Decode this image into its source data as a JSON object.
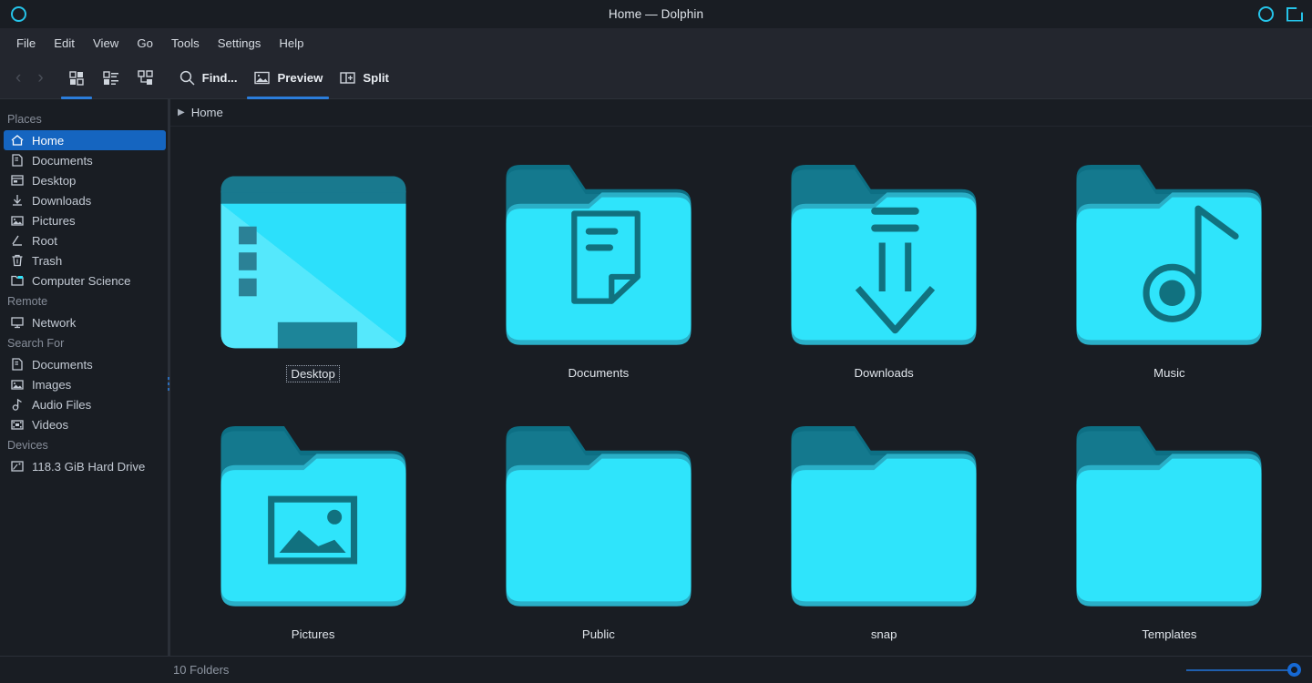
{
  "window": {
    "title": "Home — Dolphin",
    "controls": [
      {
        "name": "circle-icon",
        "label": ""
      },
      {
        "name": "maximize-corner-icon",
        "label": ""
      }
    ]
  },
  "menubar": {
    "items": [
      {
        "label": "File"
      },
      {
        "label": "Edit"
      },
      {
        "label": "View"
      },
      {
        "label": "Go"
      },
      {
        "label": "Tools"
      },
      {
        "label": "Settings"
      },
      {
        "label": "Help"
      }
    ]
  },
  "toolbar": {
    "back_label": "‹",
    "forward_label": "›",
    "buttons": [
      {
        "icon": "icons-view-icon",
        "label": "",
        "active": true
      },
      {
        "icon": "details-view-icon",
        "label": "",
        "active": false
      },
      {
        "icon": "tree-view-icon",
        "label": "",
        "active": false
      },
      {
        "icon": "search-icon",
        "label": "Find...",
        "active": false
      },
      {
        "icon": "preview-icon",
        "label": "Preview",
        "active": true
      },
      {
        "icon": "split-icon",
        "label": "Split",
        "active": false
      }
    ]
  },
  "sidebar": {
    "sections": [
      {
        "title": "Places",
        "items": [
          {
            "label": "Home",
            "icon": "home-icon",
            "selected": true
          },
          {
            "label": "Documents",
            "icon": "document-icon",
            "selected": false
          },
          {
            "label": "Desktop",
            "icon": "desktop-icon",
            "selected": false
          },
          {
            "label": "Downloads",
            "icon": "download-icon",
            "selected": false
          },
          {
            "label": "Pictures",
            "icon": "image-icon",
            "selected": false
          },
          {
            "label": "Root",
            "icon": "root-icon",
            "selected": false
          },
          {
            "label": "Trash",
            "icon": "trash-icon",
            "selected": false
          },
          {
            "label": "Computer Science",
            "icon": "folder-icon",
            "selected": false
          }
        ]
      },
      {
        "title": "Remote",
        "items": [
          {
            "label": "Network",
            "icon": "network-icon",
            "selected": false
          }
        ]
      },
      {
        "title": "Search For",
        "items": [
          {
            "label": "Documents",
            "icon": "document-icon",
            "selected": false
          },
          {
            "label": "Images",
            "icon": "image-icon",
            "selected": false
          },
          {
            "label": "Audio Files",
            "icon": "audio-icon",
            "selected": false
          },
          {
            "label": "Videos",
            "icon": "video-icon",
            "selected": false
          }
        ]
      },
      {
        "title": "Devices",
        "items": [
          {
            "label": "118.3 GiB Hard Drive",
            "icon": "harddrive-icon",
            "selected": false
          }
        ]
      }
    ]
  },
  "breadcrumb": {
    "arrow": "▶",
    "path": "Home"
  },
  "files": [
    {
      "label": "Desktop",
      "type": "desktop",
      "focused": true
    },
    {
      "label": "Documents",
      "type": "document",
      "focused": false
    },
    {
      "label": "Downloads",
      "type": "download",
      "focused": false
    },
    {
      "label": "Music",
      "type": "music",
      "focused": false
    },
    {
      "label": "Pictures",
      "type": "picture",
      "focused": false
    },
    {
      "label": "Public",
      "type": "plain",
      "focused": false
    },
    {
      "label": "snap",
      "type": "plain",
      "focused": false
    },
    {
      "label": "Templates",
      "type": "plain",
      "focused": false
    }
  ],
  "statusbar": {
    "text": "10 Folders",
    "zoom_label": ""
  },
  "colors": {
    "accent": "#1565c0",
    "folder_front": "#2fe4fb",
    "folder_back": "#0d6f84",
    "window_bg": "#191d23",
    "chrome_bg": "#23262e",
    "titlebar_icon": "#25c3e8"
  }
}
